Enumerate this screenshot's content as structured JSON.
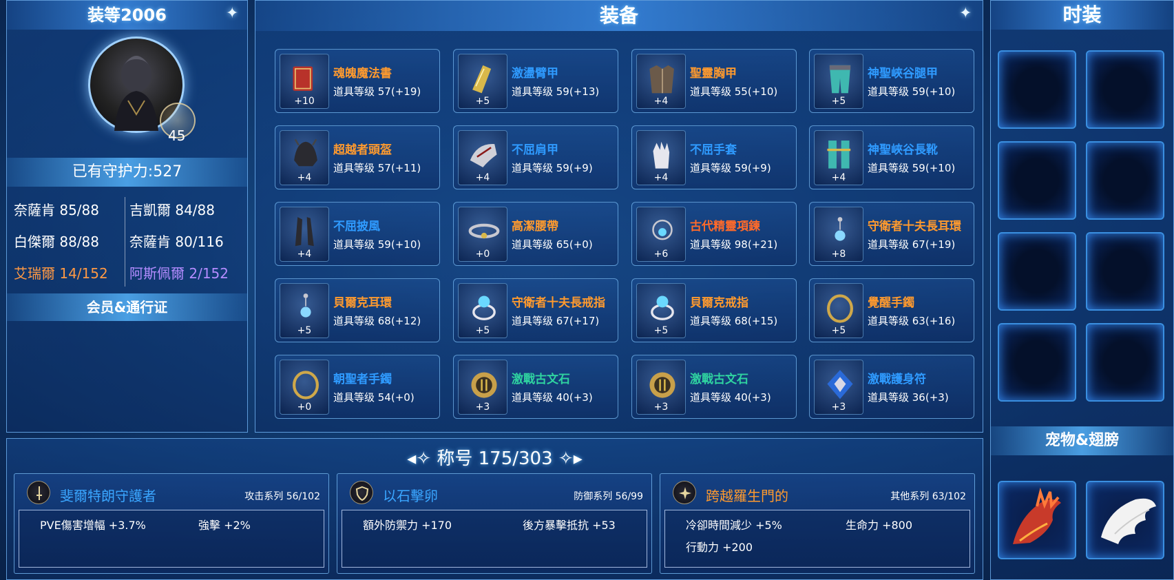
{
  "character": {
    "gear_score_label": "装等2006",
    "level": "45",
    "guard_power": "已有守护力:527",
    "stats": [
      {
        "label": "奈薩肯 85/88"
      },
      {
        "label": "吉凱爾 84/88"
      },
      {
        "label": "白傑爾 88/88"
      },
      {
        "label": "奈薩肯 80/116"
      },
      {
        "label": "艾瑞爾 14/152",
        "color": "#ff9944"
      },
      {
        "label": "阿斯佩爾 2/152",
        "color": "#b48cff"
      }
    ],
    "membership_label": "会员&通行证"
  },
  "equipment": {
    "title": "装备",
    "items": [
      {
        "name": "魂魄魔法書",
        "level": "道具等级 57(+19)",
        "plus": "+10",
        "name_color": "#ff9a2e",
        "icon": "spellbook-icon"
      },
      {
        "name": "激盪臂甲",
        "level": "道具等级 59(+13)",
        "plus": "+5",
        "name_color": "#2f9bff",
        "icon": "gold-armguard-icon"
      },
      {
        "name": "聖靈胸甲",
        "level": "道具等级 55(+10)",
        "plus": "+4",
        "name_color": "#ff9a2e",
        "icon": "chest-armor-icon"
      },
      {
        "name": "神聖峽谷腿甲",
        "level": "道具等级 59(+10)",
        "plus": "+5",
        "name_color": "#2f9bff",
        "icon": "leg-armor-icon"
      },
      {
        "name": "超越者頭盔",
        "level": "道具等级 57(+11)",
        "plus": "+4",
        "name_color": "#ff9a2e",
        "icon": "helmet-icon"
      },
      {
        "name": "不屈肩甲",
        "level": "道具等级 59(+9)",
        "plus": "+4",
        "name_color": "#2f9bff",
        "icon": "shoulder-armor-icon"
      },
      {
        "name": "不屈手套",
        "level": "道具等级 59(+9)",
        "plus": "+4",
        "name_color": "#2f9bff",
        "icon": "gloves-icon"
      },
      {
        "name": "神聖峽谷長靴",
        "level": "道具等级 59(+10)",
        "plus": "+4",
        "name_color": "#2f9bff",
        "icon": "boots-icon"
      },
      {
        "name": "不屈披風",
        "level": "道具等级 59(+10)",
        "plus": "+4",
        "name_color": "#2f9bff",
        "icon": "cape-icon"
      },
      {
        "name": "高潔腰帶",
        "level": "道具等级 65(+0)",
        "plus": "+0",
        "name_color": "#ff9a2e",
        "icon": "belt-icon"
      },
      {
        "name": "古代精靈項鍊",
        "level": "道具等级 98(+21)",
        "plus": "+6",
        "name_color": "#ff6a2a",
        "icon": "necklace-icon"
      },
      {
        "name": "守衛者十夫長耳環",
        "level": "道具等级 67(+19)",
        "plus": "+8",
        "name_color": "#ff9a2e",
        "icon": "earring-icon"
      },
      {
        "name": "貝爾克耳環",
        "level": "道具等级 68(+12)",
        "plus": "+5",
        "name_color": "#ff9a2e",
        "icon": "earring-icon"
      },
      {
        "name": "守衛者十夫長戒指",
        "level": "道具等级 67(+17)",
        "plus": "+5",
        "name_color": "#ff9a2e",
        "icon": "ring-icon"
      },
      {
        "name": "貝爾克戒指",
        "level": "道具等级 68(+15)",
        "plus": "+5",
        "name_color": "#ff9a2e",
        "icon": "ring-icon"
      },
      {
        "name": "覺醒手鐲",
        "level": "道具等级 63(+16)",
        "plus": "+5",
        "name_color": "#ff9a2e",
        "icon": "bracelet-icon"
      },
      {
        "name": "朝聖者手鐲",
        "level": "道具等级 54(+0)",
        "plus": "+0",
        "name_color": "#2f9bff",
        "icon": "bracelet-icon"
      },
      {
        "name": "激戰古文石",
        "level": "道具等级 40(+3)",
        "plus": "+3",
        "name_color": "#2fd3a0",
        "icon": "rune-stone-icon"
      },
      {
        "name": "激戰古文石",
        "level": "道具等级 40(+3)",
        "plus": "+3",
        "name_color": "#2fd3a0",
        "icon": "rune-stone-icon"
      },
      {
        "name": "激戰護身符",
        "level": "道具等级 36(+3)",
        "plus": "+3",
        "name_color": "#2f9bff",
        "icon": "amulet-icon"
      }
    ]
  },
  "fashion": {
    "title": "时装",
    "pet_wing_label": "宠物&翅膀"
  },
  "titles": {
    "header": "称号 175/303",
    "cards": [
      {
        "name": "斐爾特朗守護者",
        "name_color": "#3aa6ff",
        "category": "攻击系列 56/102",
        "icon": "sword-icon",
        "effects": [
          "PVE傷害增幅 +3.7%",
          "強擊 +2%"
        ]
      },
      {
        "name": "以石擊卵",
        "name_color": "#3aa6ff",
        "category": "防御系列 56/99",
        "icon": "shield-icon",
        "effects": [
          "額外防禦力 +170",
          "後方暴擊抵抗 +53"
        ]
      },
      {
        "name": "跨越羅生門的",
        "name_color": "#ff9a2e",
        "category": "其他系列 63/102",
        "icon": "star-icon",
        "effects": [
          "冷卻時間減少 +5%",
          "生命力 +800",
          "行動力 +200"
        ]
      }
    ]
  }
}
